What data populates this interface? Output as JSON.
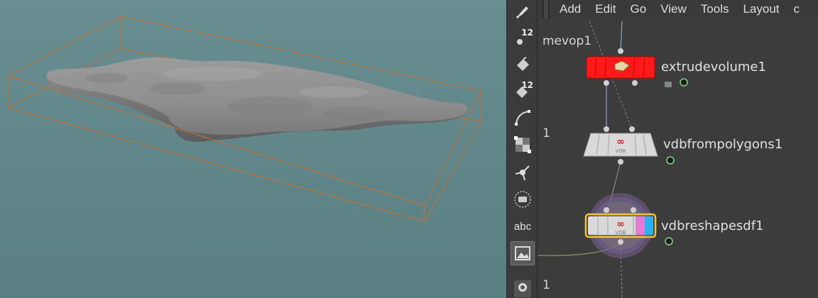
{
  "menubar": {
    "items": [
      "Add",
      "Edit",
      "Go",
      "View",
      "Tools",
      "Layout",
      "c"
    ]
  },
  "network": {
    "path": "mevop1",
    "edge_numbers": [
      "1",
      "1"
    ],
    "nodes": [
      {
        "name": "extrudevolume1",
        "type": "extrude",
        "color": "#ff1a1a",
        "selected": false
      },
      {
        "name": "vdbfrompolygons1",
        "type": "vdb",
        "color": "#d9d9d9",
        "selected": false
      },
      {
        "name": "vdbreshapesdf1",
        "type": "vdb",
        "color": "#d9d9d9",
        "selected": true
      }
    ]
  },
  "shelf": {
    "tools": [
      {
        "icon": "pen-icon",
        "badge": ""
      },
      {
        "icon": "point-count-icon",
        "badge": "12"
      },
      {
        "icon": "paint-bucket-icon",
        "badge": ""
      },
      {
        "icon": "attribute-paint-icon",
        "badge": "12"
      },
      {
        "icon": "curve-icon",
        "badge": ""
      },
      {
        "icon": "checker-icon",
        "badge": ""
      },
      {
        "icon": "transform-handle-icon",
        "badge": ""
      },
      {
        "icon": "circle-select-icon",
        "badge": ""
      },
      {
        "icon": "text-icon",
        "badge": "abc"
      },
      {
        "icon": "image-icon",
        "badge": ""
      },
      {
        "icon": "pin-icon",
        "badge": ""
      }
    ]
  },
  "colors": {
    "viewport_bg": "#658a8e",
    "bounding_box": "#b5743f",
    "selection_outline": "#f2c52a",
    "extrude_node": "#ff1a1a",
    "flag_pink": "#e879d8",
    "flag_blue": "#2ab3ef"
  }
}
